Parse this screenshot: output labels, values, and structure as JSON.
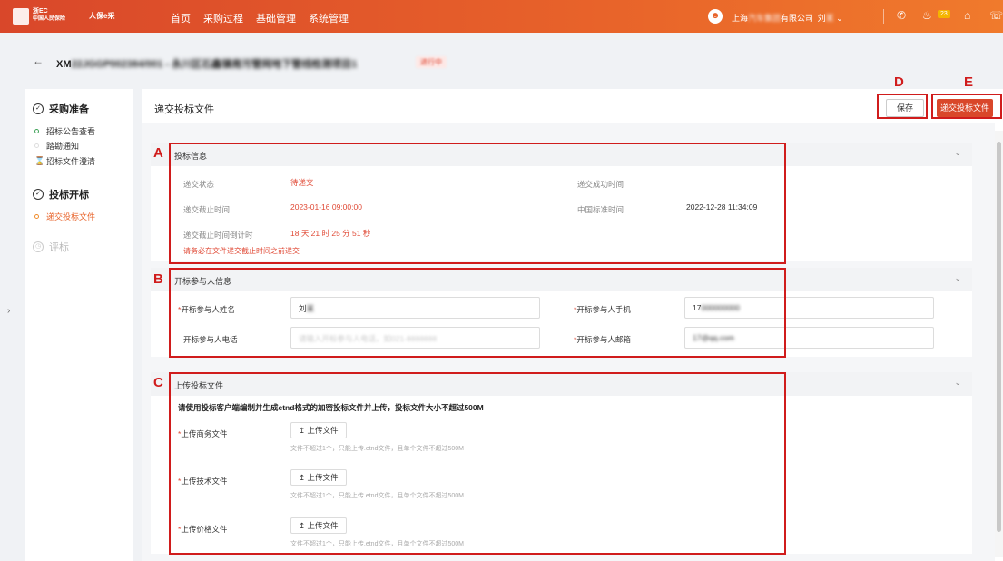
{
  "topbar": {
    "logo_line1": "浙EC",
    "logo_line2": "中国人民保险",
    "logo_sub": "人保e采",
    "nav": [
      "首页",
      "采购过程",
      "基础管理",
      "系统管理"
    ],
    "company": "上海汽车集团有限公司",
    "company_visible_prefix": "上海",
    "company_visible_suffix": "有限公司",
    "user": "刘",
    "badge": "23"
  },
  "project": {
    "code_prefix": "XM",
    "code_rest": "22JGGP002384/001 - 永川区石鑫镇南污管网地下管线检测项目1",
    "tag": "进行中"
  },
  "sidebar": {
    "groups": [
      {
        "title": "采购准备",
        "items": [
          "招标公告查看",
          "踏勘通知",
          "招标文件澄清"
        ]
      },
      {
        "title": "投标开标",
        "items": [
          "递交投标文件"
        ]
      },
      {
        "title": "评标",
        "items": []
      }
    ],
    "expand_glyph": "›"
  },
  "main": {
    "title": "递交投标文件",
    "save_label": "保存",
    "submit_label": "递交投标文件"
  },
  "bid_info": {
    "title": "投标信息",
    "status_label": "递交状态",
    "status_value": "待递交",
    "success_time_label": "递交成功时间",
    "deadline_label": "递交截止时间",
    "deadline_value": "2023-01-16 09:00:00",
    "cn_time_label": "中国标准时间",
    "cn_time_value": "2022-12-28 11:34:09",
    "countdown_label": "递交截止时间倒计时",
    "countdown_value": "18 天 21 时 25 分 51 秒",
    "warning": "请务必在文件递交截止时间之前递交"
  },
  "participant": {
    "title": "开标参与人信息",
    "name_label": "开标参与人姓名",
    "name_value": "刘",
    "mobile_label": "开标参与人手机",
    "mobile_value": "17",
    "phone_label": "开标参与人电话",
    "phone_placeholder": "请输入开标参与人电话，如021-8888888",
    "email_label": "开标参与人邮箱",
    "email_value": "17@qq.com"
  },
  "upload": {
    "title": "上传投标文件",
    "notice": "请使用投标客户端编制并生成etnd格式的加密投标文件并上传，投标文件大小不超过500M",
    "button_label": "上传文件",
    "hint": "文件不超过1个，只能上传.etnd文件，且单个文件不超过500M",
    "files": [
      "上传商务文件",
      "上传技术文件",
      "上传价格文件"
    ]
  },
  "annotations": [
    "A",
    "B",
    "C",
    "D",
    "E"
  ],
  "colors": {
    "primary": "#d9472a",
    "annotation": "#d01c1c",
    "warning_text": "#e04a36"
  },
  "icons": [
    "back-arrow-icon",
    "chevron-down-icon",
    "phone-icon",
    "bell-icon",
    "home-icon",
    "headset-icon",
    "upload-icon",
    "check-circle-icon",
    "hourglass-icon"
  ]
}
